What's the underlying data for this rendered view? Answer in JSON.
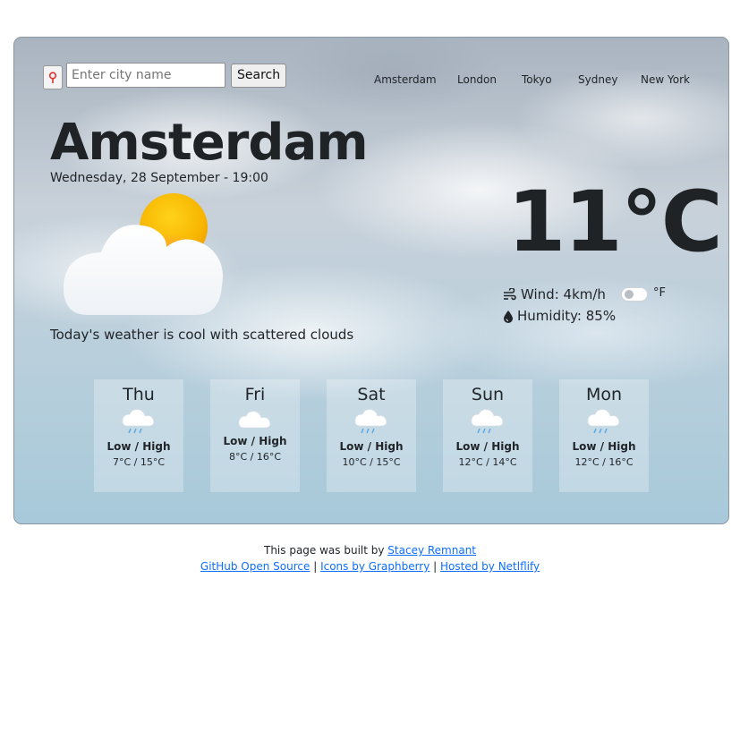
{
  "search": {
    "placeholder": "Enter city name",
    "button_label": "Search",
    "pin_icon": "map-pin-icon"
  },
  "quick_cities": [
    "Amsterdam",
    "London",
    "Tokyo",
    "Sydney",
    "New York"
  ],
  "current": {
    "city": "Amsterdam",
    "datetime": "Wednesday, 28 September - 19:00",
    "icon": "partly-cloudy-icon",
    "description": "Today's weather is cool with scattered clouds",
    "temperature": "11°C",
    "wind_label": "Wind: 4km/h",
    "humidity_label": "Humidity: 85%",
    "unit_toggle_label": "°F"
  },
  "forecast": [
    {
      "day": "Thu",
      "icon": "rain-cloud-icon",
      "label": "Low / High",
      "range": "7°C / 15°C"
    },
    {
      "day": "Fri",
      "icon": "cloud-icon",
      "label": "Low / High",
      "range": "8°C / 16°C"
    },
    {
      "day": "Sat",
      "icon": "rain-cloud-icon",
      "label": "Low / High",
      "range": "10°C / 15°C"
    },
    {
      "day": "Sun",
      "icon": "rain-cloud-icon",
      "label": "Low / High",
      "range": "12°C / 14°C"
    },
    {
      "day": "Mon",
      "icon": "rain-cloud-icon",
      "label": "Low / High",
      "range": "12°C / 16°C"
    }
  ],
  "footer": {
    "built_by_prefix": "This page was built by",
    "author_link": "Stacey Remnant",
    "github_link": "GitHub Open Source",
    "icons_link": "Icons by Graphberry",
    "hosted_link": "Hosted by Netlflify",
    "separator": "|"
  },
  "colors": {
    "link": "#0d6efd",
    "text": "#212529",
    "sun": "#f5b400",
    "pin": "#e03131"
  }
}
